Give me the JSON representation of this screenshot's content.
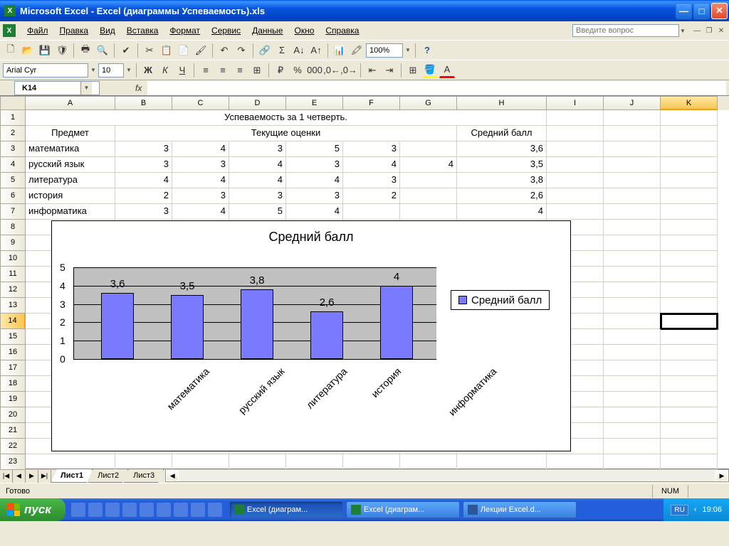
{
  "window": {
    "title": "Microsoft Excel - Excel (диаграммы Успеваемость).xls"
  },
  "menu": {
    "file": "Файл",
    "edit": "Правка",
    "view": "Вид",
    "insert": "Вставка",
    "format": "Формат",
    "service": "Сервис",
    "data": "Данные",
    "window": "Окно",
    "help": "Справка",
    "ask_placeholder": "Введите вопрос"
  },
  "toolbar": {
    "font_name": "Arial Cyr",
    "font_size": "10",
    "zoom": "100%"
  },
  "namebox": "K14",
  "columns": [
    "A",
    "B",
    "C",
    "D",
    "E",
    "F",
    "G",
    "H",
    "I",
    "J",
    "K"
  ],
  "data_title": "Успеваемость за 1 четверть.",
  "headers": {
    "subject": "Предмет",
    "grades": "Текущие оценки",
    "avg": "Средний балл"
  },
  "rows": [
    {
      "subject": "математика",
      "g": [
        "3",
        "4",
        "3",
        "5",
        "3",
        ""
      ],
      "avg": "3,6"
    },
    {
      "subject": "русский язык",
      "g": [
        "3",
        "3",
        "4",
        "3",
        "4",
        "4"
      ],
      "avg": "3,5"
    },
    {
      "subject": "литература",
      "g": [
        "4",
        "4",
        "4",
        "4",
        "3",
        ""
      ],
      "avg": "3,8"
    },
    {
      "subject": "история",
      "g": [
        "2",
        "3",
        "3",
        "3",
        "2",
        ""
      ],
      "avg": "2,6"
    },
    {
      "subject": "информатика",
      "g": [
        "3",
        "4",
        "5",
        "4",
        "",
        ""
      ],
      "avg": "4"
    }
  ],
  "chart_data": {
    "type": "bar",
    "title": "Средний балл",
    "categories": [
      "математика",
      "русский язык",
      "литература",
      "история",
      "информатика"
    ],
    "values": [
      3.6,
      3.5,
      3.8,
      2.6,
      4
    ],
    "value_labels": [
      "3,6",
      "3,5",
      "3,8",
      "2,6",
      "4"
    ],
    "legend": "Средний балл",
    "ylim": [
      0,
      5
    ],
    "yticks": [
      0,
      1,
      2,
      3,
      4,
      5
    ]
  },
  "sheets": {
    "s1": "Лист1",
    "s2": "Лист2",
    "s3": "Лист3"
  },
  "status": {
    "ready": "Готово",
    "num": "NUM"
  },
  "taskbar": {
    "start": "пуск",
    "t1": "Excel (диаграм...",
    "t2": "Excel (диаграм...",
    "t3": "Лекции Excel.d...",
    "lang": "RU",
    "clock": "19:06"
  }
}
